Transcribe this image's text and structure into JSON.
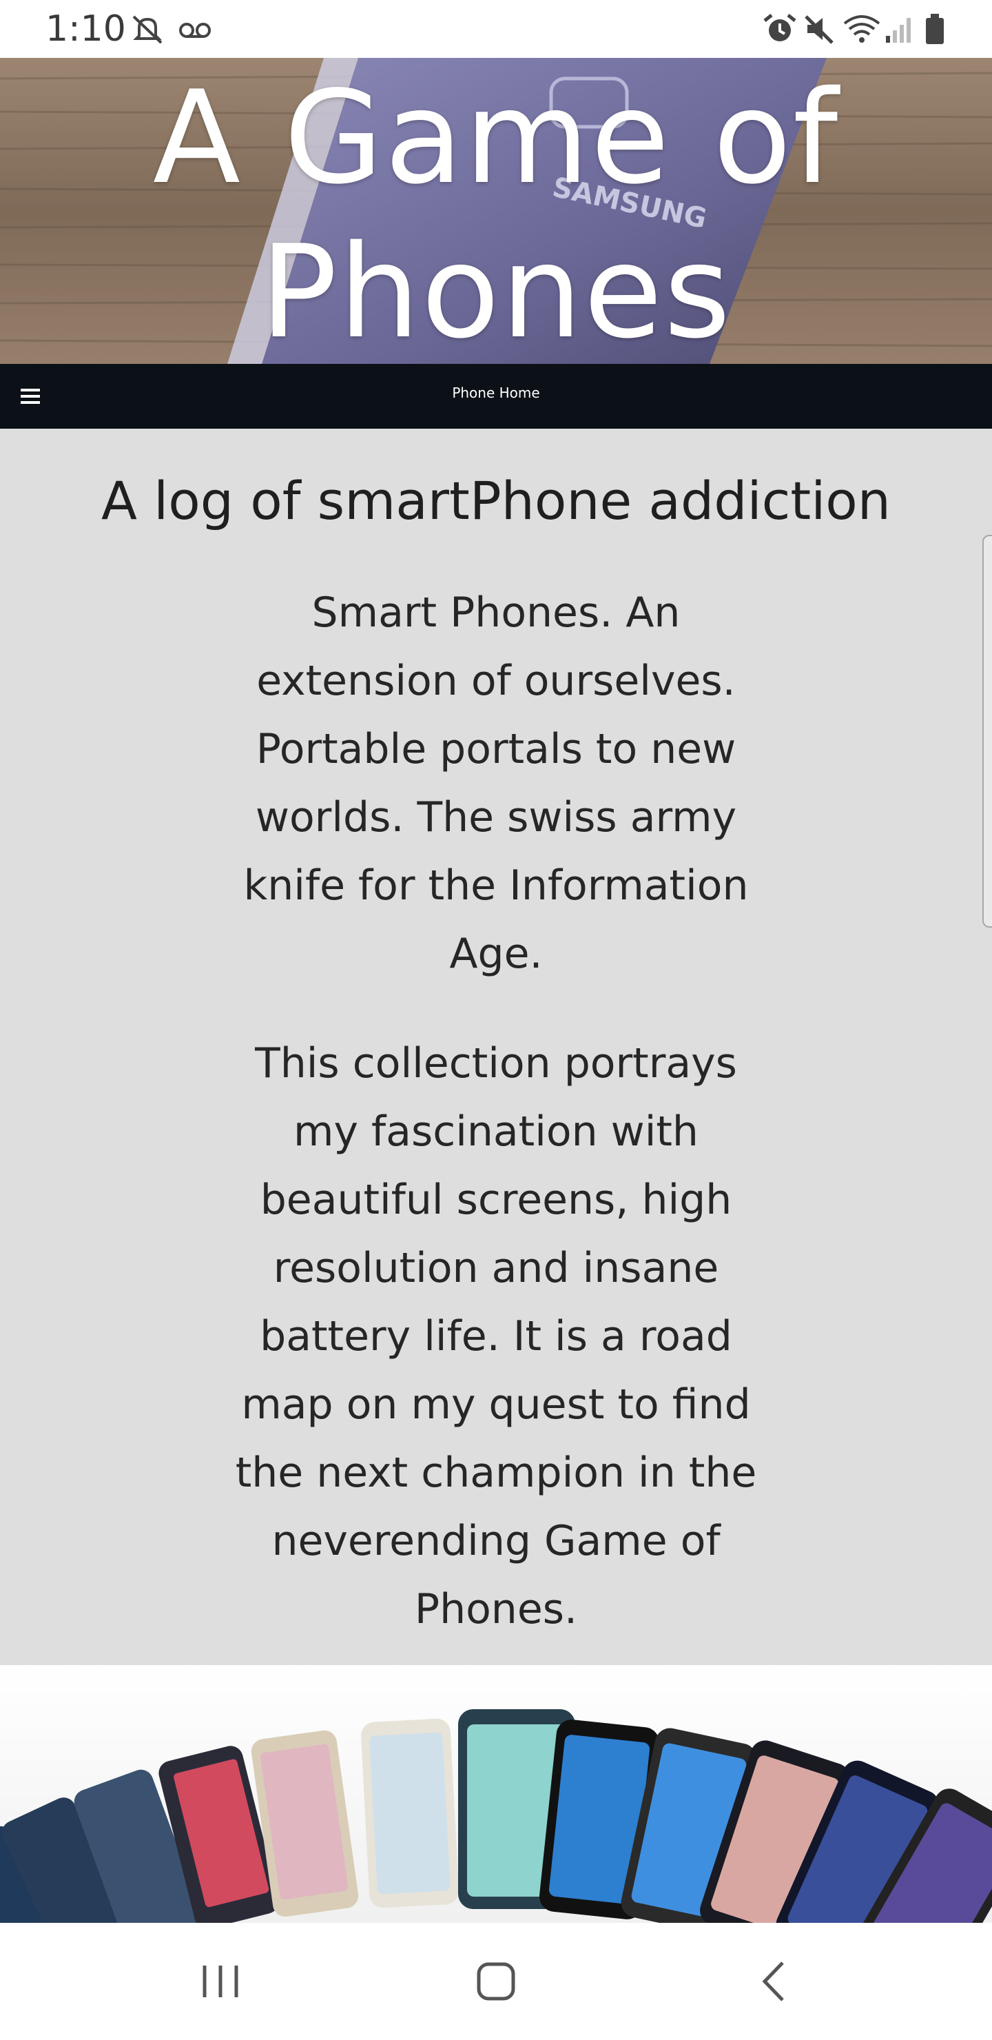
{
  "status_bar": {
    "time": "1:10",
    "left_icons": [
      "notifications-off-icon",
      "voicemail-icon"
    ],
    "right_icons": [
      "alarm-icon",
      "mute-icon",
      "wifi-icon",
      "signal-icon",
      "battery-icon"
    ]
  },
  "hero": {
    "title": "A Game of Phones",
    "background": "samsung-phone-on-wood-image"
  },
  "navbar": {
    "menu_icon": "hamburger-menu-icon",
    "title": "Phone Home"
  },
  "main": {
    "heading": "A log of smartPhone addiction",
    "paragraph1": "Smart Phones. An extension of ourselves. Portable portals to new worlds. The swiss army knife for the Information Age.",
    "paragraph2": "This collection portrays my fascination with beautiful screens, high resolution and insane battery life. It is a road map on my quest to find the next champion in the neverending Game of Phones."
  },
  "banner": {
    "image": "samsung-phones-lineup-image"
  },
  "bottom_nav": {
    "buttons": [
      "recent-apps-icon",
      "home-icon",
      "back-icon"
    ]
  },
  "colors": {
    "navbar_bg": "#0b1116",
    "content_bg": "#dedede",
    "text": "#262626"
  }
}
